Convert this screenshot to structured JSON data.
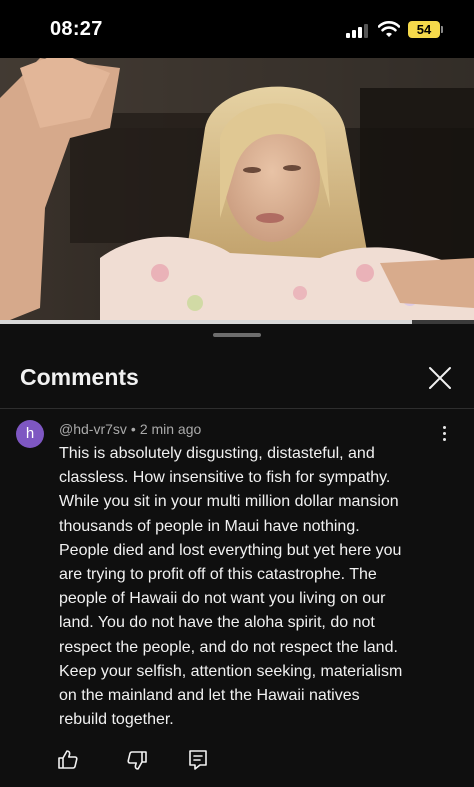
{
  "status_bar": {
    "time": "08:27",
    "battery": "54",
    "icons": [
      "cellular-signal-icon",
      "wifi-icon",
      "battery-icon"
    ]
  },
  "video": {
    "progress": 0.87
  },
  "comments_panel": {
    "title": "Comments",
    "close_icon": "close-icon"
  },
  "comment": {
    "avatar_letter": "h",
    "author": "@hd-vr7sv",
    "separator": "•",
    "time_ago": "2 min ago",
    "text_lines": [
      "This is absolutely disgusting, distasteful, and",
      "classless. How insensitive to fish for sympathy.",
      "While you sit in your multi million dollar mansion",
      "thousands of people in Maui have nothing.",
      "People died and lost everything but yet here you",
      "are trying to profit off of this catastrophe. The",
      "people of Hawaii do not want you living on our",
      "land. You do not have the aloha spirit, do not",
      "respect the people, and do not respect the land.",
      "Keep your selfish, attention seeking, materialism",
      "on the mainland and let the Hawaii natives",
      "rebuild together."
    ],
    "actions": [
      "thumbs-up-icon",
      "thumbs-down-icon",
      "reply-icon"
    ]
  },
  "colors": {
    "background": "#0f0f0f",
    "avatar": "#7e57c2",
    "battery": "#f5d94b",
    "meta_text": "#aaaaaa"
  }
}
